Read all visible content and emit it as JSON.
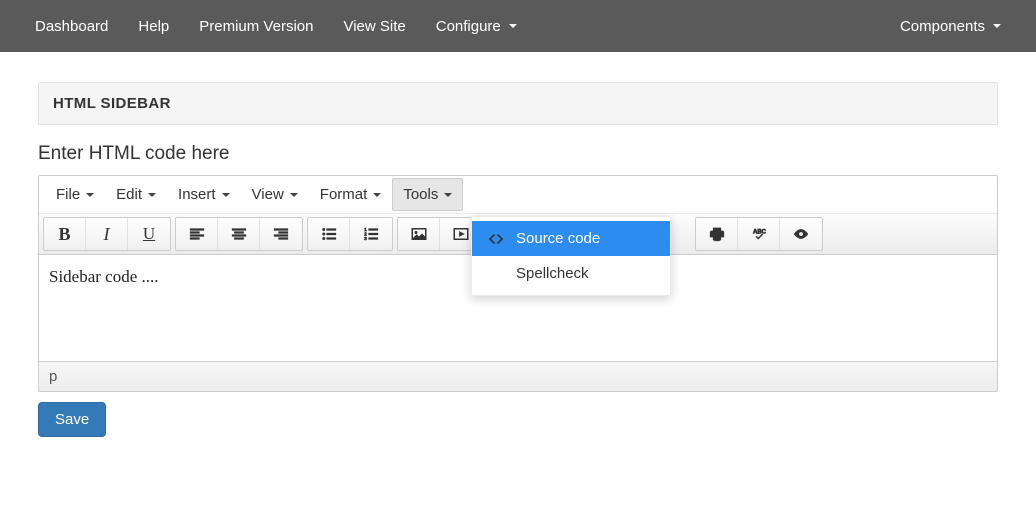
{
  "topnav": {
    "left": [
      {
        "label": "Dashboard",
        "dropdown": false
      },
      {
        "label": "Help",
        "dropdown": false
      },
      {
        "label": "Premium Version",
        "dropdown": false
      },
      {
        "label": "View Site",
        "dropdown": false
      },
      {
        "label": "Configure",
        "dropdown": true
      }
    ],
    "right": [
      {
        "label": "Components",
        "dropdown": true
      }
    ]
  },
  "panel": {
    "title": "HTML SIDEBAR"
  },
  "label": "Enter HTML code here",
  "editor": {
    "menus": [
      "File",
      "Edit",
      "Insert",
      "View",
      "Format",
      "Tools"
    ],
    "open_menu_index": 5,
    "dropdown": {
      "items": [
        {
          "label": "Source code",
          "icon": "code",
          "active": true
        },
        {
          "label": "Spellcheck",
          "icon": "",
          "active": false
        }
      ]
    },
    "content": "Sidebar code ....",
    "statusbar": "p"
  },
  "save_label": "Save"
}
